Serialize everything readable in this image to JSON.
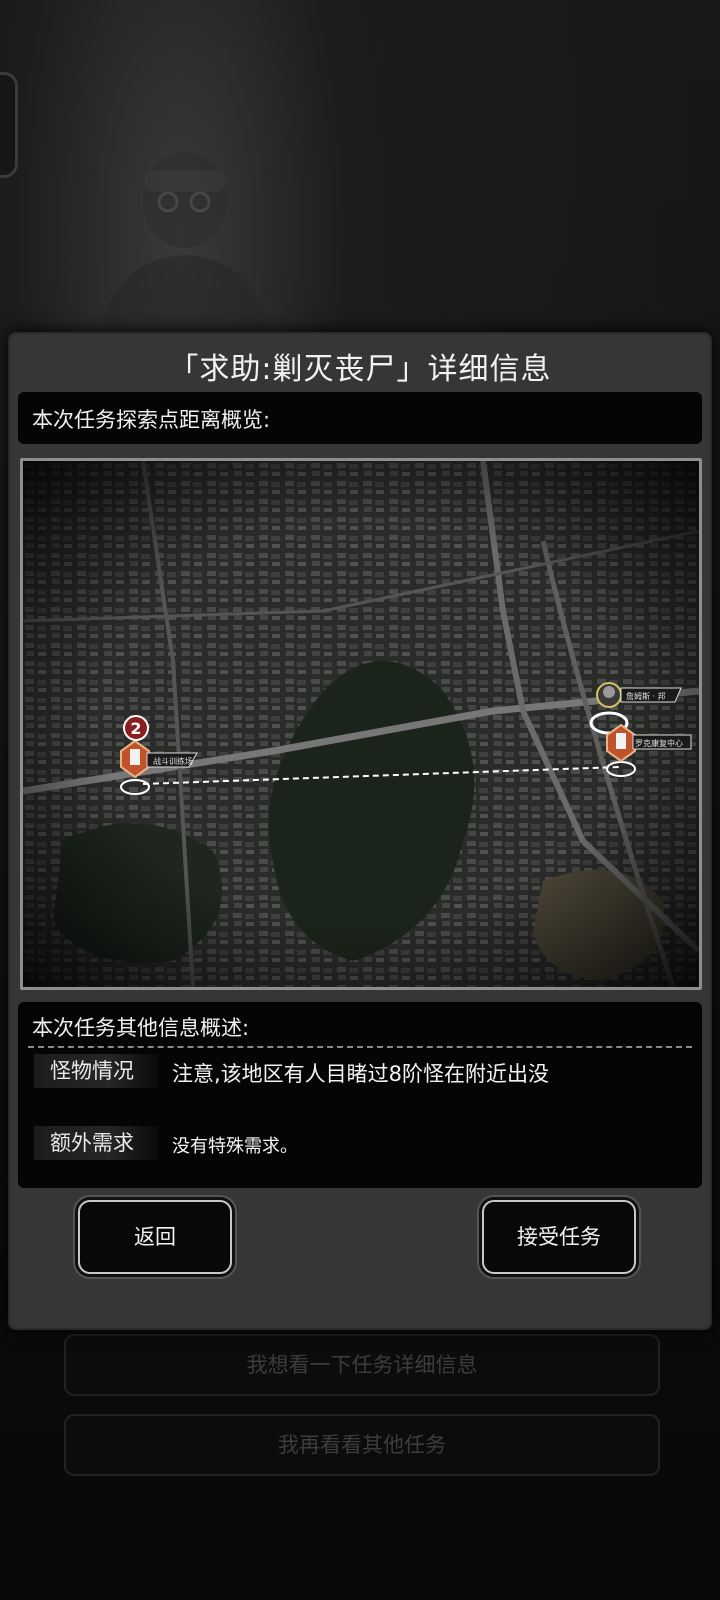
{
  "background": {
    "options": [
      {
        "label": "我想看一下任务详细信息"
      },
      {
        "label": "我再看看其他任务"
      }
    ]
  },
  "dialog": {
    "title": "「求助:剿灭丧尸」详细信息",
    "map_heading": "本次任务探索点距离概览:",
    "map": {
      "start_badge": "2",
      "start_label": "战斗训练场",
      "npc_label": "詹姆斯 · 邦",
      "dest_label": "罗克康复中心",
      "route_color": "#ffffff",
      "badge_color": "#8b1e1e",
      "marker_color": "#c0532a"
    },
    "info_heading": "本次任务其他信息概述:",
    "rows": [
      {
        "label": "怪物情况",
        "value": "注意,该地区有人目睹过8阶怪在附近出没"
      },
      {
        "label": "额外需求",
        "value": "没有特殊需求。"
      }
    ],
    "buttons": {
      "back": "返回",
      "accept": "接受任务"
    }
  }
}
